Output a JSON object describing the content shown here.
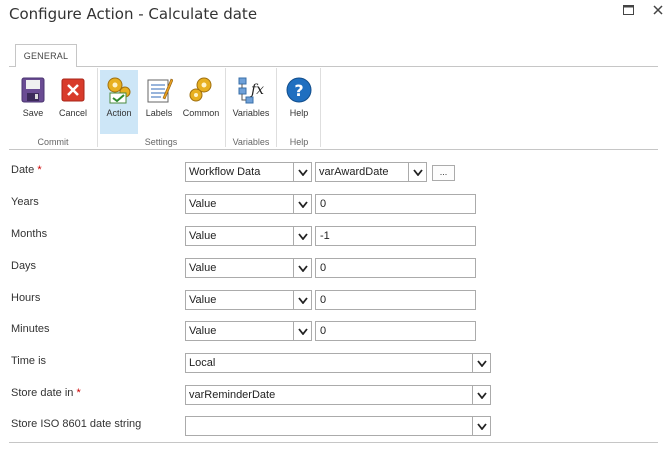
{
  "window": {
    "title": "Configure Action - Calculate date"
  },
  "ribbon": {
    "tab": "GENERAL",
    "buttons": {
      "save": "Save",
      "cancel": "Cancel",
      "action": "Action",
      "labels": "Labels",
      "common": "Common",
      "variables": "Variables",
      "help": "Help"
    },
    "groups": {
      "commit": "Commit",
      "settings": "Settings",
      "variables": "Variables",
      "help": "Help"
    }
  },
  "form": {
    "date": {
      "label": "Date",
      "required": "*",
      "source": "Workflow Data",
      "value": "varAwardDate",
      "browse": "..."
    },
    "years": {
      "label": "Years",
      "type": "Value",
      "value": "0"
    },
    "months": {
      "label": "Months",
      "type": "Value",
      "value": "-1"
    },
    "days": {
      "label": "Days",
      "type": "Value",
      "value": "0"
    },
    "hours": {
      "label": "Hours",
      "type": "Value",
      "value": "0"
    },
    "minutes": {
      "label": "Minutes",
      "type": "Value",
      "value": "0"
    },
    "time_is": {
      "label": "Time is",
      "value": "Local"
    },
    "store_date": {
      "label": "Store date in",
      "required": "*",
      "value": "varReminderDate"
    },
    "store_iso": {
      "label": "Store ISO 8601 date string",
      "value": ""
    }
  }
}
